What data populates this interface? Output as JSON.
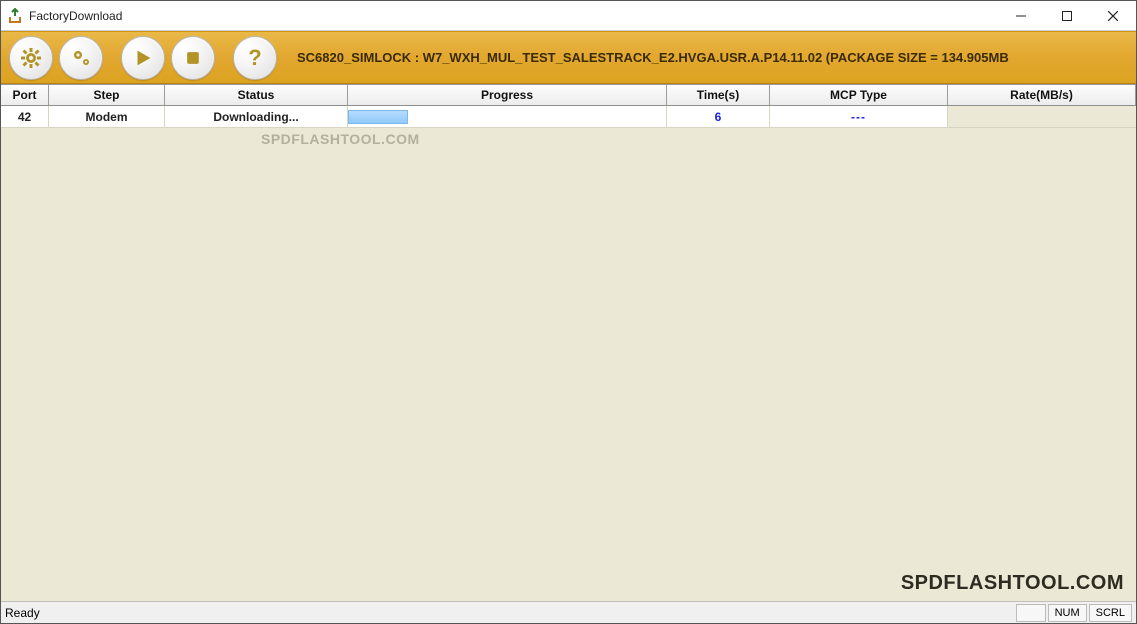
{
  "window": {
    "title": "FactoryDownload"
  },
  "toolbar": {
    "info_text": "SC6820_SIMLOCK : W7_WXH_MUL_TEST_SALESTRACK_E2.HVGA.USR.A.P14.11.02 (PACKAGE SIZE = 134.905MB"
  },
  "columns": {
    "port": "Port",
    "step": "Step",
    "status": "Status",
    "progress": "Progress",
    "time": "Time(s)",
    "mcp": "MCP Type",
    "rate": "Rate(MB/s)"
  },
  "row": {
    "port": "42",
    "step": "Modem",
    "status": "Downloading...",
    "time": "6",
    "mcp": "---",
    "rate": ""
  },
  "watermarks": {
    "wm1": "SPDFLASHTOOL.COM",
    "wm2": "SPDFLASHTOOL.COM"
  },
  "statusbar": {
    "ready": "Ready",
    "num": "NUM",
    "scrl": "SCRL"
  }
}
